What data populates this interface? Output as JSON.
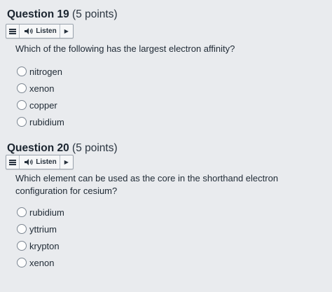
{
  "questions": [
    {
      "title": "Question 19",
      "points": "(5 points)",
      "listen": {
        "label": "Listen"
      },
      "prompt": "Which of the following has the largest electron affinity?",
      "options": [
        "nitrogen",
        "xenon",
        "copper",
        "rubidium"
      ]
    },
    {
      "title": "Question 20",
      "points": "(5 points)",
      "listen": {
        "label": "Listen"
      },
      "prompt": "Which element can be used as the core in the shorthand electron configuration for cesium?",
      "options": [
        "rubidium",
        "yttrium",
        "krypton",
        "xenon"
      ]
    }
  ],
  "icons": {
    "menu": "menu-icon",
    "speaker": "speaker-icon",
    "play": "play-icon"
  }
}
